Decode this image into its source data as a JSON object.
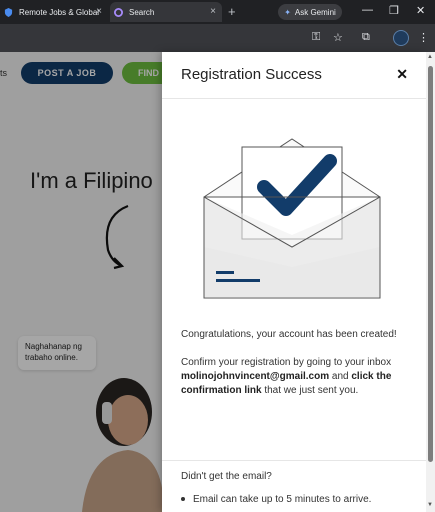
{
  "browser": {
    "tabs": [
      {
        "title": "Remote Jobs & Global"
      },
      {
        "title": "Search"
      }
    ],
    "new_tab": "+",
    "gemini_label": "Ask Gemini",
    "minimize": "—",
    "restore": "❐",
    "close": "✕"
  },
  "page": {
    "nav_fragment": "ts",
    "post_job": "POST A JOB",
    "find": "FIND",
    "hero_text": "I'm a Filipino",
    "bubble_text": "Naghahanap ng trabaho online."
  },
  "panel": {
    "title": "Registration Success",
    "close_symbol": "✕",
    "message1": "Congratulations, your account has been created!",
    "message2_pre": "Confirm your registration by going to your inbox ",
    "email": "molinojohnvincent@gmail.com",
    "message2_mid": " and ",
    "message2_link": "click the confirmation link",
    "message2_post": " that we just sent you.",
    "didnt_get": "Didn't get the email?",
    "bullet1": "Email can take up to 5 minutes to arrive."
  },
  "colors": {
    "navy": "#123c6a",
    "green": "#6dbf3f"
  }
}
